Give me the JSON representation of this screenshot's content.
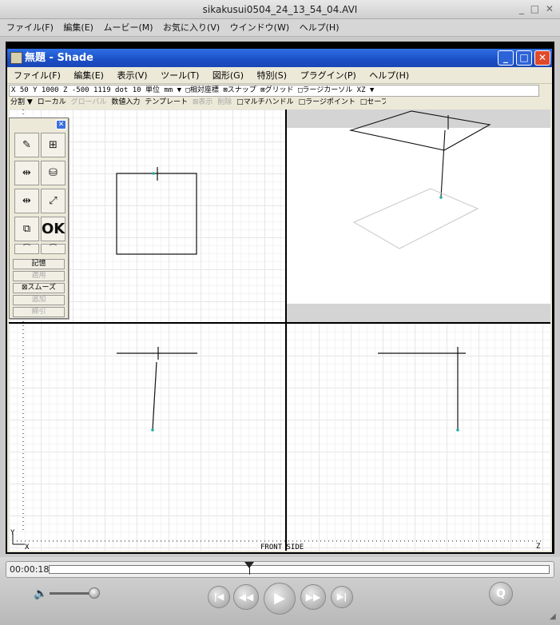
{
  "player": {
    "title": "sikakusui0504_24_13_54_04.AVI",
    "window_buttons": "_ □ ✕",
    "menu": [
      "ファイル(F)",
      "編集(E)",
      "ムービー(M)",
      "お気に入り(V)",
      "ウインドウ(W)",
      "ヘルプ(H)"
    ],
    "timecode": "00:00:18",
    "progress": 0.4
  },
  "shade": {
    "title": "無題 - Shade",
    "minimize": "_",
    "maximize": "□",
    "close": "✕",
    "menu": [
      "ファイル(F)",
      "編集(E)",
      "表示(V)",
      "ツール(T)",
      "図形(G)",
      "特別(S)",
      "プラグイン(P)",
      "ヘルプ(H)"
    ],
    "status": {
      "line": "X      50 Y      1000 Z      -500      1119 dot      10 単位 mm ▼ □相対座標 ⊠スナップ ⊠グリッド □ラージカーソル XZ ▼"
    },
    "status2": {
      "items": [
        "分割 ▼",
        "ローカル",
        "グローバル",
        "数値入力",
        "テンプレート",
        "⊠表示",
        "削除",
        "□マルチハンドル",
        "□ラージポイント",
        "□セーフゾーン"
      ]
    },
    "toolbox": {
      "close": "✕",
      "ok": "OK",
      "buttons": [
        "記憶",
        "適用",
        "⊠スムーズ",
        "追加",
        "締引"
      ]
    },
    "view_labels": {
      "front_side": "FRONT SIDE",
      "y_axis": "Y",
      "x_axis": "X",
      "z_axis": "Z"
    }
  },
  "colors": {
    "titlebar_blue": "#1b4fc6",
    "close_red": "#e04a2a",
    "point_cyan": "#22aaaa"
  }
}
